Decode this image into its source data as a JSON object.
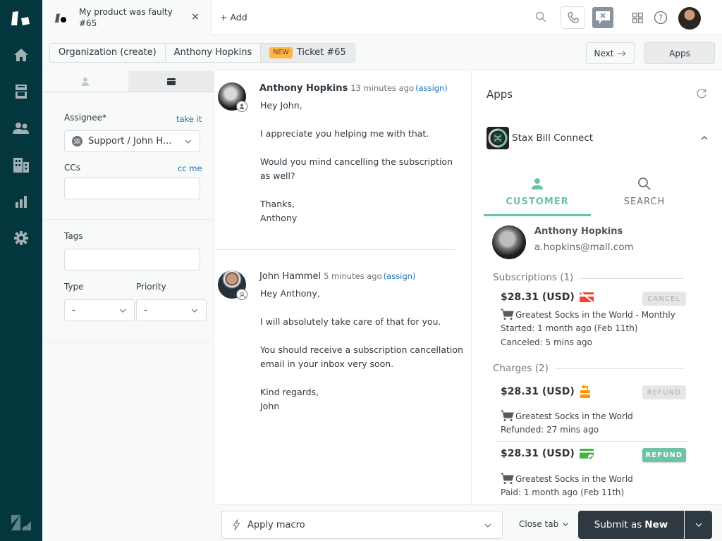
{
  "nav": {
    "items": [
      {
        "name": "home",
        "icon": "home-icon"
      },
      {
        "name": "views",
        "icon": "inbox-icon"
      },
      {
        "name": "customers",
        "icon": "users-icon"
      },
      {
        "name": "organizations",
        "icon": "building-icon"
      },
      {
        "name": "reporting",
        "icon": "bar-chart-icon"
      },
      {
        "name": "admin",
        "icon": "gear-icon"
      }
    ]
  },
  "topbar": {
    "ticket_tab": {
      "title": "My product was faulty",
      "subtitle": "#65"
    },
    "add_label": "Add"
  },
  "subbar": {
    "breadcrumb": [
      "Organization (create)",
      "Anthony Hopkins",
      "Ticket #65"
    ],
    "badge": "NEW",
    "next_label": "Next",
    "apps_label": "Apps"
  },
  "props": {
    "assignee_label": "Assignee*",
    "take_it": "take it",
    "assignee_value": "Support / John H...",
    "ccs_label": "CCs",
    "cc_me": "cc me",
    "ccs_value": "",
    "tags_label": "Tags",
    "tags_value": "",
    "type_label": "Type",
    "type_value": "-",
    "priority_label": "Priority",
    "priority_value": "-"
  },
  "conversation": [
    {
      "author": "Anthony Hopkins",
      "time": "13 minutes ago",
      "assign": "(assign)",
      "lines": [
        "Hey John,",
        "",
        "I appreciate you helping me with that.",
        "",
        "Would you mind cancelling the subscription",
        "as well?",
        "",
        "Thanks,",
        "Anthony"
      ]
    },
    {
      "author": "John Hammel",
      "time": "5 minutes ago",
      "assign": "(assign)",
      "lines": [
        "Hey Anthony,",
        "",
        "I will absolutely take care of that for you.",
        "",
        "You should receive a subscription cancellation",
        "email in your inbox very soon.",
        "",
        "Kind regards,",
        "John"
      ]
    }
  ],
  "bottombar": {
    "macro_label": "Apply macro",
    "close_tab": "Close tab",
    "submit_prefix": "Submit as",
    "submit_status": "New"
  },
  "apps": {
    "title": "Apps",
    "app_name": "Stax Bill Connect",
    "tabs": [
      {
        "label": "CUSTOMER",
        "active": true
      },
      {
        "label": "SEARCH",
        "active": false
      }
    ],
    "customer": {
      "name": "Anthony Hopkins",
      "email": "a.hopkins@mail.com"
    },
    "subscriptions_title": "Subscriptions (1)",
    "subscription": {
      "price": "$28.31 (USD)",
      "status_icon": "card-cancelled-icon",
      "button": "CANCEL",
      "product": "Greatest Socks in the World - Monthly",
      "started": "Started: 1 month ago (Feb 11th)",
      "canceled": "Canceled: 5 mins ago"
    },
    "charges_title": "Charges (2)",
    "charges": [
      {
        "price": "$28.31 (USD)",
        "status_icon": "refund-icon",
        "button": "REFUND",
        "enabled": false,
        "product": "Greatest Socks in the World",
        "status": "Refunded: 27 mins ago"
      },
      {
        "price": "$28.31 (USD)",
        "status_icon": "card-paid-icon",
        "button": "REFUND",
        "enabled": true,
        "product": "Greatest Socks in the World",
        "status": "Paid: 1 month ago (Feb 11th)"
      }
    ],
    "colors": {
      "accent": "#6bc4a7",
      "cancel_red": "#f44336",
      "refund_orange": "#ff9800",
      "paid_green": "#4caf50"
    }
  }
}
